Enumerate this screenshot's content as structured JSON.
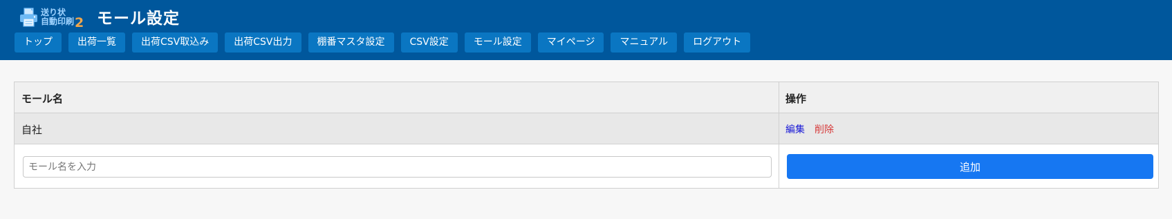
{
  "header": {
    "logo": {
      "line1": "送り状",
      "line2": "自動印刷",
      "number": "2"
    },
    "title": "モール設定"
  },
  "nav": {
    "items": [
      {
        "label": "トップ"
      },
      {
        "label": "出荷一覧"
      },
      {
        "label": "出荷CSV取込み"
      },
      {
        "label": "出荷CSV出力"
      },
      {
        "label": "棚番マスタ設定"
      },
      {
        "label": "CSV設定"
      },
      {
        "label": "モール設定"
      },
      {
        "label": "マイページ"
      },
      {
        "label": "マニュアル"
      },
      {
        "label": "ログアウト"
      }
    ]
  },
  "table": {
    "columns": {
      "name": "モール名",
      "actions": "操作"
    },
    "rows": [
      {
        "name": "自社",
        "edit": "編集",
        "delete": "削除"
      }
    ]
  },
  "form": {
    "placeholder": "モール名を入力",
    "value": "",
    "add_label": "追加"
  },
  "colors": {
    "header_bg": "#00579c",
    "nav_button": "#0a76c2",
    "primary_button": "#1677f2",
    "edit_link": "#1a1ad6",
    "delete_link": "#d63a3a"
  }
}
